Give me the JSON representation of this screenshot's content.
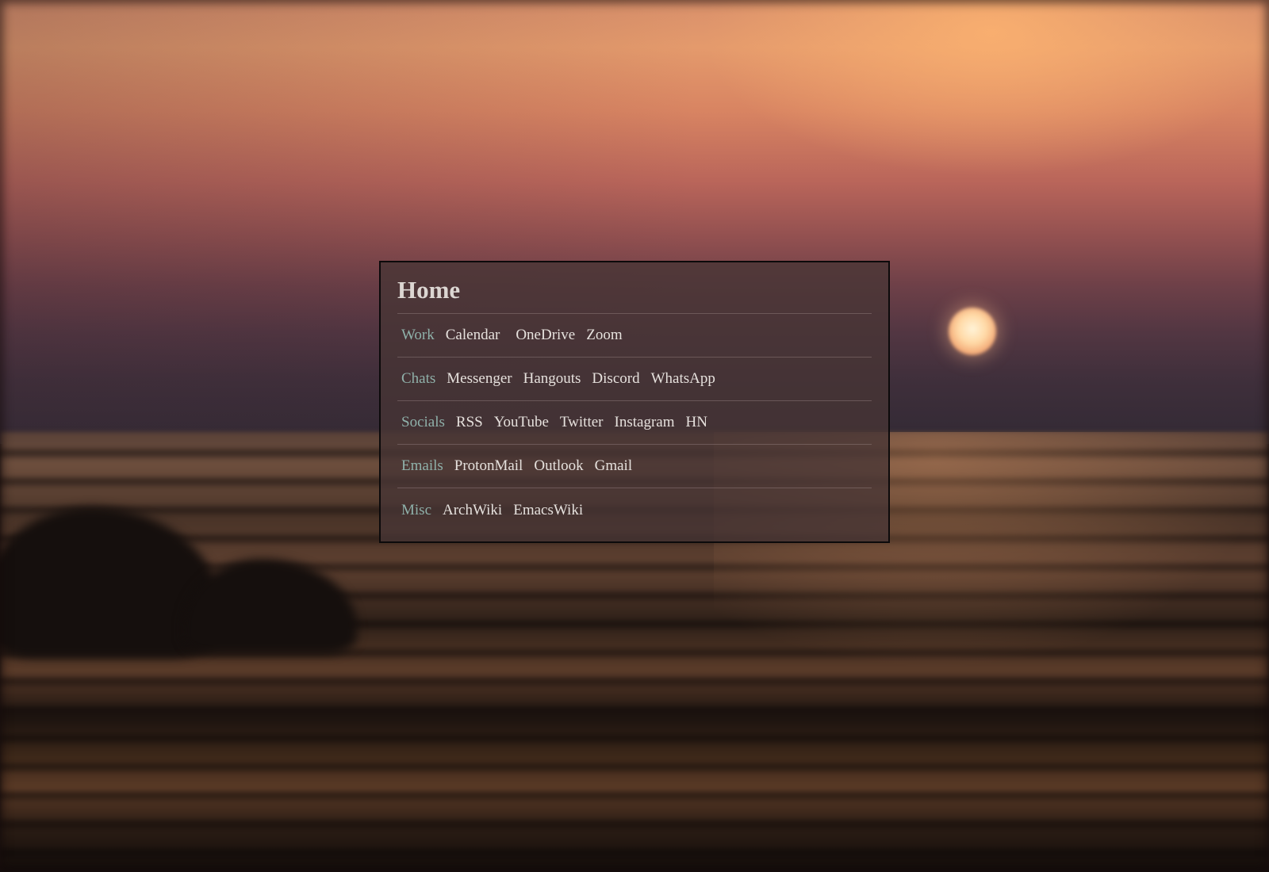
{
  "panel": {
    "title": "Home",
    "rows": [
      {
        "label": "Work",
        "links": [
          "Calendar",
          "OneDrive",
          "Zoom"
        ]
      },
      {
        "label": "Chats",
        "links": [
          "Messenger",
          "Hangouts",
          "Discord",
          "WhatsApp"
        ]
      },
      {
        "label": "Socials",
        "links": [
          "RSS",
          "YouTube",
          "Twitter",
          "Instagram",
          "HN"
        ]
      },
      {
        "label": "Emails",
        "links": [
          "ProtonMail",
          "Outlook",
          "Gmail"
        ]
      },
      {
        "label": "Misc",
        "links": [
          "ArchWiki",
          "EmacsWiki"
        ]
      }
    ]
  },
  "colors": {
    "category_label": "#8fb1aa",
    "link_text": "#e6e1dd",
    "title_text": "#dcd6d2",
    "panel_border": "#0c0a0b"
  },
  "background": {
    "icons": [
      "sunset-wallpaper"
    ]
  }
}
